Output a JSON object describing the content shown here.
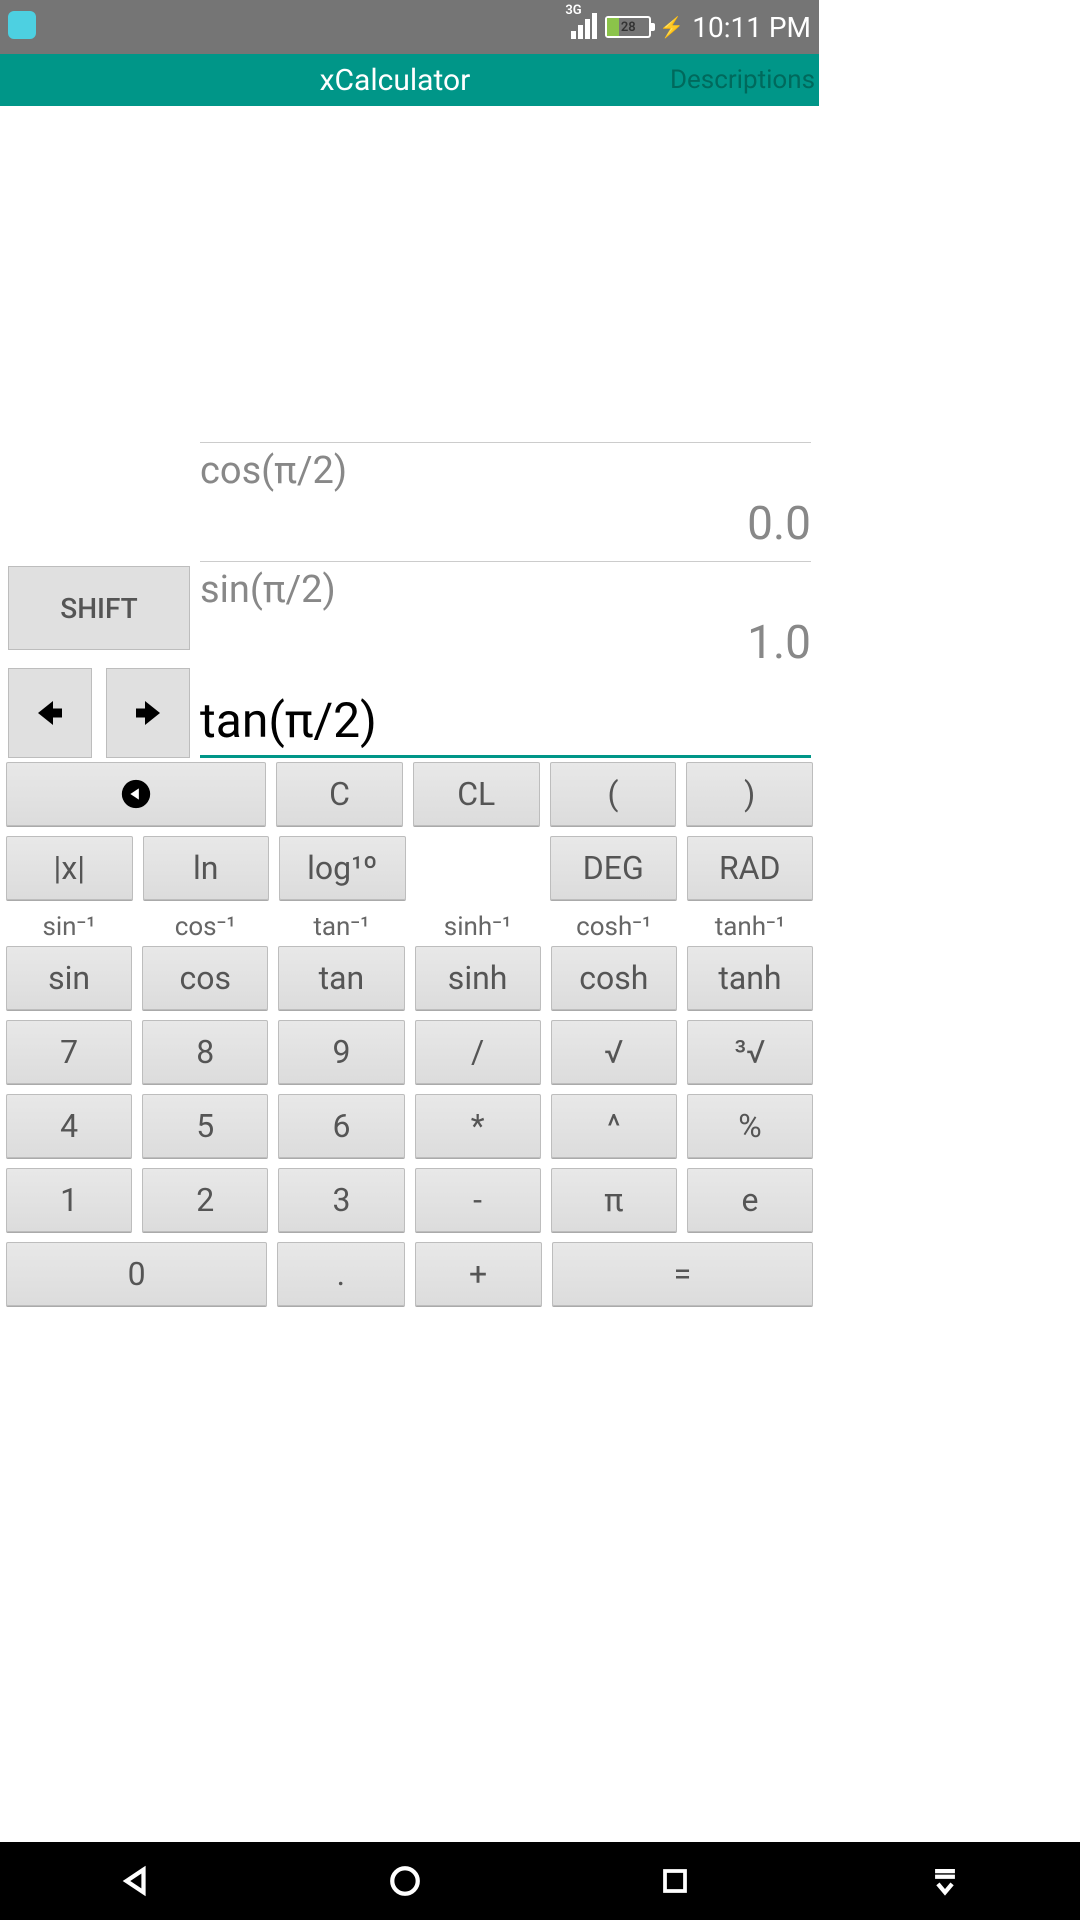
{
  "statusbar": {
    "network_label": "3G",
    "battery_pct": "28",
    "time": "10:11 PM"
  },
  "appbar": {
    "title": "xCalculator",
    "descriptions": "Descriptions"
  },
  "display": {
    "shift_label": "SHIFT",
    "history": [
      {
        "expr": "cos(π/2)",
        "result": "0.0"
      },
      {
        "expr": "sin(π/2)",
        "result": "1.0"
      }
    ],
    "input": "tan(π/2)"
  },
  "keypad": {
    "row1": {
      "c": "C",
      "cl": "CL",
      "lp": "(",
      "rp": ")"
    },
    "row2": {
      "abs": "|x|",
      "ln": "ln",
      "log10": "log¹º",
      "deg": "DEG",
      "rad": "RAD"
    },
    "shift_labels": {
      "asin": "sin⁻¹",
      "acos": "cos⁻¹",
      "atan": "tan⁻¹",
      "asinh": "sinh⁻¹",
      "acosh": "cosh⁻¹",
      "atanh": "tanh⁻¹"
    },
    "row3": {
      "sin": "sin",
      "cos": "cos",
      "tan": "tan",
      "sinh": "sinh",
      "cosh": "cosh",
      "tanh": "tanh"
    },
    "row4": {
      "n7": "7",
      "n8": "8",
      "n9": "9",
      "div": "/",
      "sqrt": "√",
      "cbrt": "³√"
    },
    "row5": {
      "n4": "4",
      "n5": "5",
      "n6": "6",
      "mul": "*",
      "pow": "^",
      "pct": "%"
    },
    "row6": {
      "n1": "1",
      "n2": "2",
      "n3": "3",
      "sub": "-",
      "pi": "π",
      "e": "e"
    },
    "row7": {
      "n0": "0",
      "dot": ".",
      "add": "+",
      "eq": "="
    }
  }
}
